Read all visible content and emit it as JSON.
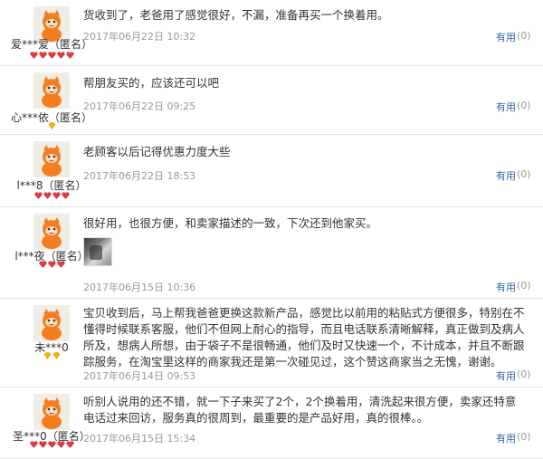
{
  "colors": {
    "avatar_orange": "#f47d1f",
    "gem_red": "#e4393c",
    "gem_yellow": "#f7b500",
    "link_blue": "#3366aa",
    "date_gray": "#999999"
  },
  "reviews": [
    {
      "nickname": "爱***爱（匿名）",
      "badge_type": "red-heart",
      "badge_count": 5,
      "content": "货收到了，老爸用了感觉很好，不漏，准备再买一个换着用。",
      "date": "2017年06月22日 10:32",
      "useful_label": "有用",
      "useful_count": "(0)"
    },
    {
      "nickname": "心***依（匿名）",
      "badge_type": "yellow-diamond",
      "badge_count": 1,
      "content": "帮朋友买的，应该还可以吧",
      "date": "2017年06月22日 09:25",
      "useful_label": "有用",
      "useful_count": "(0)"
    },
    {
      "nickname": "l***8（匿名）",
      "badge_type": "red-heart",
      "badge_count": 4,
      "content": "老顾客以后记得优惠力度大些",
      "date": "2017年06月22日 18:53",
      "useful_label": "有用",
      "useful_count": "(0)"
    },
    {
      "nickname": "l***夜（匿名）",
      "badge_type": "red-heart",
      "badge_count": 3,
      "content": "很好用，也很方便，和卖家描述的一致，下次还到他家买。",
      "has_photo": true,
      "date": "2017年06月15日 10:36",
      "useful_label": "有用",
      "useful_count": "(0)"
    },
    {
      "nickname": "未***0",
      "badge_type": "yellow-diamond",
      "badge_count": 2,
      "content": "宝贝收到后，马上帮我爸爸更换这款新产品，感觉比以前用的粘贴式方便很多，特别在不懂得时候联系客服，他们不但网上耐心的指导，而且电话联系清晰解释，真正做到及病人所及，想病人所想，由于袋子不是很畅通，他们及时又快速一个，不计成本，并且不断跟踪服务，在淘宝里这样的商家我还是第一次碰见过，这个赞这商家当之无愧，谢谢。",
      "date": "2017年06月14日 09:53",
      "useful_label": "有用",
      "useful_count": "(0)"
    },
    {
      "nickname": "圣***0（匿名）",
      "badge_type": "red-heart",
      "badge_count": 5,
      "content": "听别人说用的还不错，就一下子来买了2个，2个换着用，清洗起来很方便，卖家还特意电话过来回访，服务真的很周到，最重要的是产品好用，真的很棒。。",
      "date": "2017年06月15日 15:34",
      "useful_label": "有用",
      "useful_count": "(0)"
    }
  ]
}
